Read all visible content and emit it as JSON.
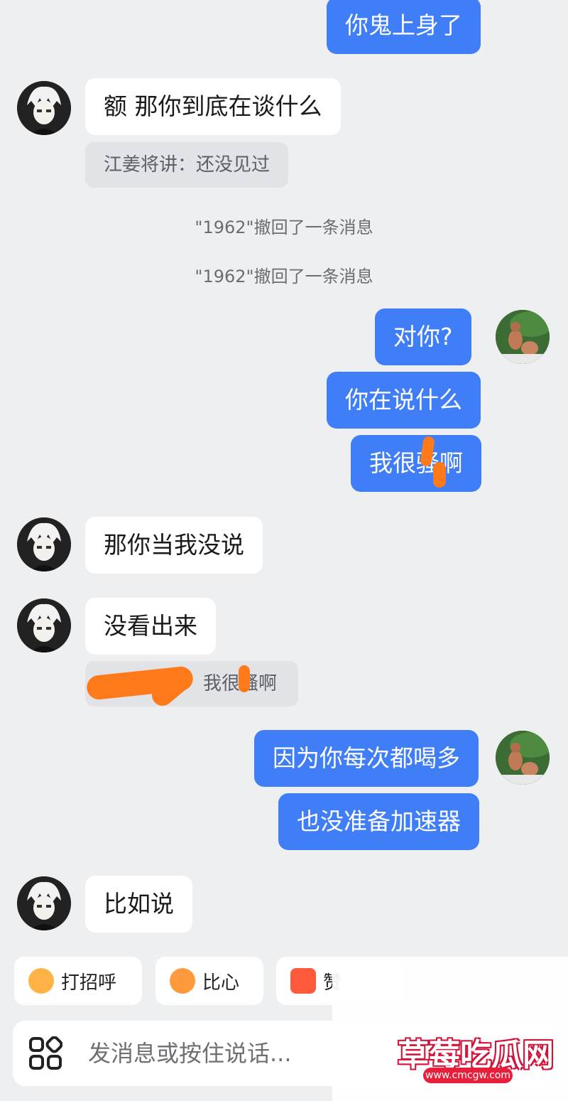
{
  "messages": {
    "m1": "你鬼上身了",
    "m2": "额 那你到底在谈什么",
    "m2_quote": "江姜将讲：还没见过",
    "recall1": "\"1962\"撤回了一条消息",
    "recall2": "\"1962\"撤回了一条消息",
    "m3": "对你?",
    "m4": "你在说什么",
    "m5": "我很骚啊",
    "m6": "那你当我没说",
    "m7": "没看出来",
    "m7_quote": "我很骚啊",
    "m8": "因为你每次都喝多",
    "m9": "也没准备加速器",
    "m10": "比如说"
  },
  "quick_replies": {
    "greet": "打招呼",
    "heart": "比心",
    "like": "赞"
  },
  "input": {
    "placeholder": "发消息或按住说话..."
  },
  "watermark": {
    "title": "草莓吃瓜网",
    "url": "www.cmcgw.com"
  },
  "colors": {
    "outgoing_bubble": "#3f7ef7",
    "incoming_bubble": "#ffffff",
    "background": "#eeeff1",
    "redaction": "#ff7a1a"
  }
}
